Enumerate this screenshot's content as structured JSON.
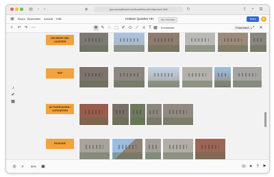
{
  "browser": {
    "url": "app.conceptboard.com/board/lsw-w4v-kfqe-lmv4-4w3",
    "icons": [
      "sidebar-icon",
      "back-icon",
      "forward-icon",
      "shield-icon",
      "refresh-icon",
      "share-icon",
      "new-tab-icon",
      "tabs-icon"
    ]
  },
  "app": {
    "menu": [
      "Board",
      "Bearbeiten",
      "Ansicht",
      "Hilfe"
    ],
    "title": "Holsten Quartier HH",
    "title_badge": "Nur Zeichnen",
    "share_label": "Teilen",
    "avatar_initial": "K"
  },
  "toolbar": {
    "tools": [
      "✥",
      "✎",
      "☞",
      "⬚",
      "✐",
      "⬭",
      "∕",
      "≡",
      "T",
      "▭",
      "▦"
    ],
    "active_tool": 0,
    "section_label": "Kommentar",
    "right_label": "Präsentation"
  },
  "sections": [
    {
      "label": "GELBEWE UND LAGEGEN"
    },
    {
      "label": "HOF"
    },
    {
      "label": "AKTIVIERUNGEN / VORGÄRTEN"
    },
    {
      "label": "FASSADE"
    }
  ],
  "photo_colors": {
    "building": "#8c8075",
    "brick": "#9a5a49",
    "sky": "#a8c2e0",
    "grey": "#b6b8ba",
    "green": "#7d8d5c"
  },
  "sidebar_icons": [
    "bell-icon",
    "check-icon",
    "grid-icon"
  ],
  "bottom": {
    "zoom": "50%",
    "left_icons": [
      "target-icon",
      "zoom-icon",
      "hand-icon"
    ],
    "right_icons": [
      "phone-icon",
      "pin-icon",
      "help-icon",
      "flag-icon"
    ]
  }
}
